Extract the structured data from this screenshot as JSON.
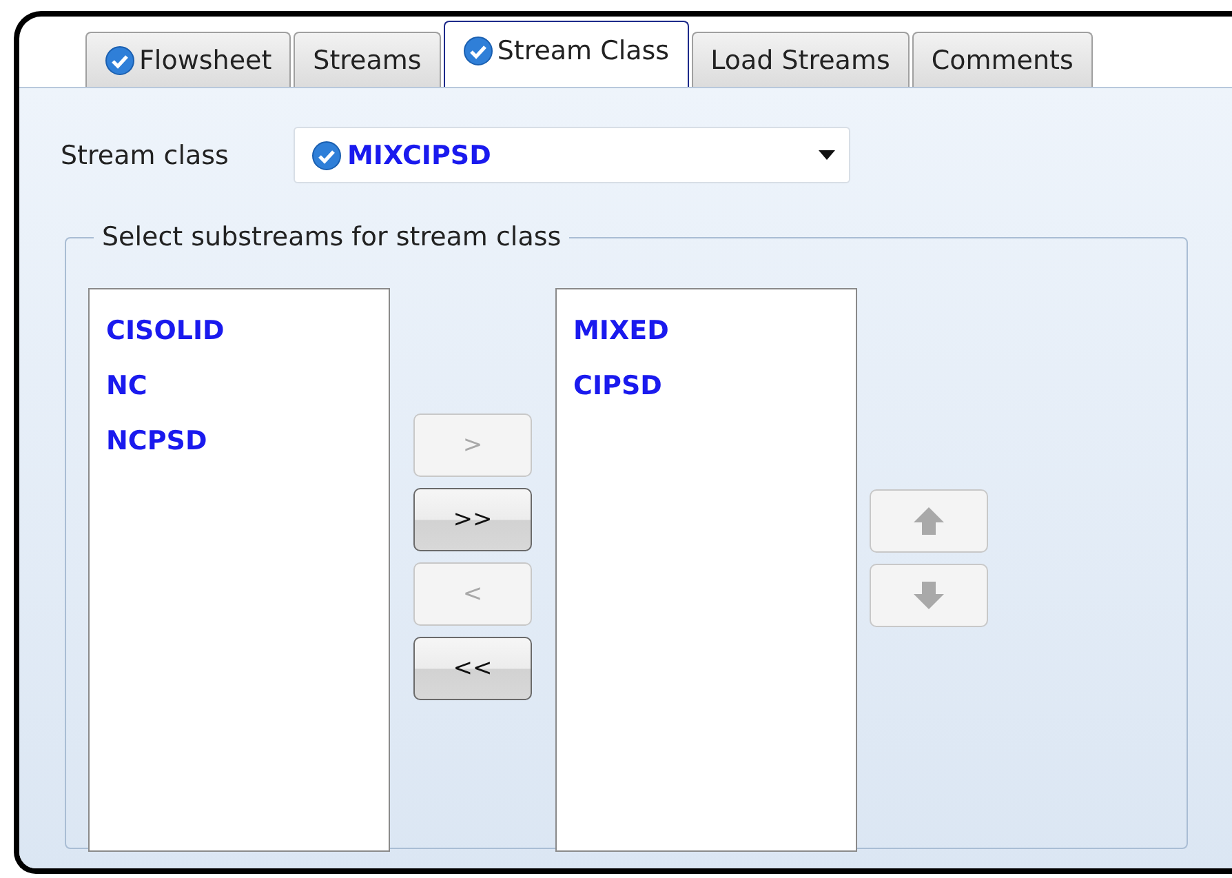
{
  "tabs": [
    {
      "label": "Flowsheet",
      "complete": true,
      "selected": false
    },
    {
      "label": "Streams",
      "complete": false,
      "selected": false
    },
    {
      "label": "Stream Class",
      "complete": true,
      "selected": true
    },
    {
      "label": "Load Streams",
      "complete": false,
      "selected": false
    },
    {
      "label": "Comments",
      "complete": false,
      "selected": false
    }
  ],
  "stream_class": {
    "label": "Stream class",
    "value": "MIXCIPSD",
    "complete": true
  },
  "group": {
    "title": "Select substreams for stream class",
    "available": [
      "CISOLID",
      "NC",
      "NCPSD"
    ],
    "selected_list": [
      "MIXED",
      "CIPSD"
    ],
    "transfer_buttons": [
      {
        "label": ">",
        "disabled": true
      },
      {
        "label": ">>",
        "disabled": false
      },
      {
        "label": "<",
        "disabled": true
      },
      {
        "label": "<<",
        "disabled": false
      }
    ],
    "order_buttons": [
      {
        "kind": "up",
        "disabled": true
      },
      {
        "kind": "down",
        "disabled": true
      }
    ]
  }
}
